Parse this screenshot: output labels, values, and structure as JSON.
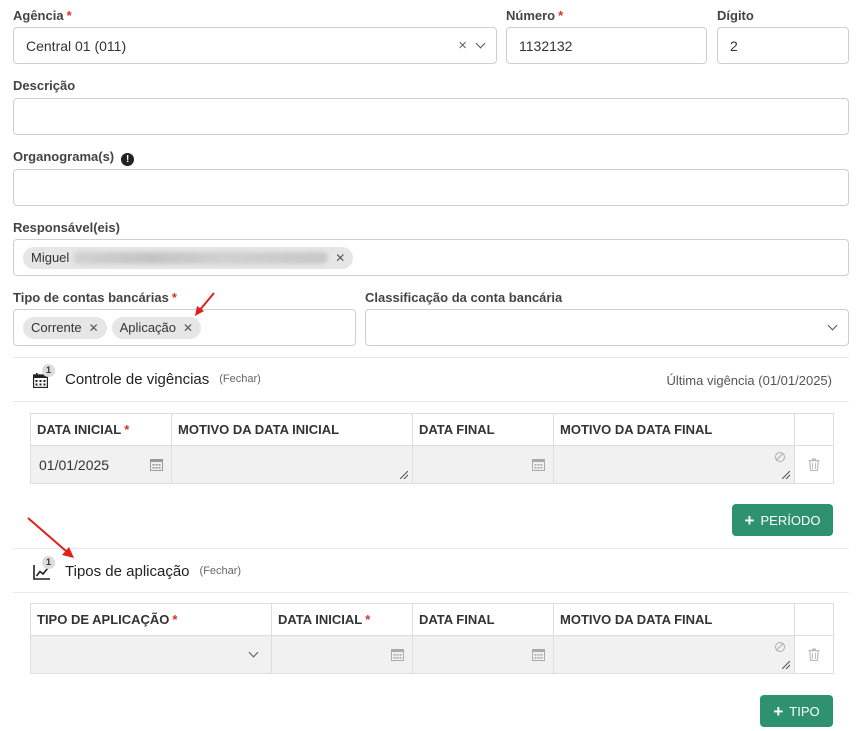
{
  "form": {
    "agencia": {
      "label": "Agência",
      "required": "*",
      "value": "Central 01 (011)"
    },
    "numero": {
      "label": "Número",
      "required": "*",
      "value": "1132132"
    },
    "digito": {
      "label": "Dígito",
      "value": "2"
    },
    "descricao": {
      "label": "Descrição",
      "value": ""
    },
    "organograma": {
      "label": "Organograma(s)",
      "value": ""
    },
    "responsaveis": {
      "label": "Responsável(eis)",
      "tags": [
        "Miguel"
      ]
    },
    "tipo_contas": {
      "label": "Tipo de contas bancárias",
      "required": "*",
      "tags": [
        "Corrente",
        "Aplicação"
      ]
    },
    "classificacao": {
      "label": "Classificação da conta bancária",
      "value": ""
    }
  },
  "vigencias": {
    "title": "Controle de vigências",
    "badge": "1",
    "toggle": "(Fechar)",
    "last": "Última vigência (01/01/2025)",
    "columns": [
      "DATA INICIAL",
      "MOTIVO DA DATA INICIAL",
      "DATA FINAL",
      "MOTIVO DA DATA FINAL"
    ],
    "required_mark": "*",
    "rows": [
      {
        "data_inicial": "01/01/2025",
        "motivo_inicial": "",
        "data_final": "",
        "motivo_final": ""
      }
    ],
    "add_button": "PERÍODO"
  },
  "aplicacao": {
    "title": "Tipos de aplicação",
    "badge": "1",
    "toggle": "(Fechar)",
    "columns": [
      "TIPO DE APLICAÇÃO",
      "DATA INICIAL",
      "DATA FINAL",
      "MOTIVO DA DATA FINAL"
    ],
    "required_mark": "*",
    "rows": [
      {
        "tipo": "",
        "data_inicial": "",
        "data_final": "",
        "motivo_final": ""
      }
    ],
    "add_button": "TIPO"
  },
  "colors": {
    "primary": "#2e9170",
    "required": "#d9322b",
    "annotation": "#e0201b"
  },
  "icons": [
    "clear-icon",
    "chevron-down-icon",
    "info-icon",
    "tag-remove-icon",
    "calendar-icon",
    "trash-icon",
    "ban-icon",
    "chart-line-icon",
    "plus-icon"
  ]
}
